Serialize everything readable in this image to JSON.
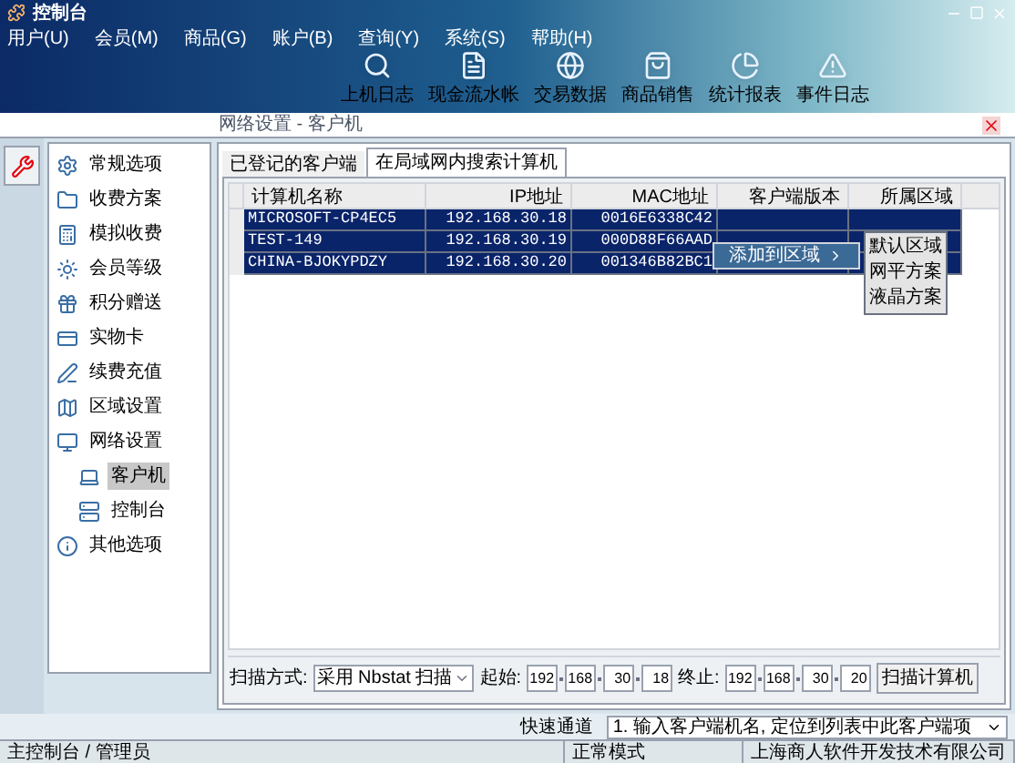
{
  "window": {
    "title": "控制台"
  },
  "menu": [
    "用户(U)",
    "会员(M)",
    "商品(G)",
    "账户(B)",
    "查询(Y)",
    "系统(S)",
    "帮助(H)"
  ],
  "toolbar": [
    "上机日志",
    "现金流水帐",
    "交易数据",
    "商品销售",
    "统计报表",
    "事件日志"
  ],
  "breadcrumb": "网络设置 - 客户机",
  "sidebar": {
    "items": [
      {
        "label": "常规选项",
        "selected": false
      },
      {
        "label": "收费方案",
        "selected": false
      },
      {
        "label": "模拟收费",
        "selected": false
      },
      {
        "label": "会员等级",
        "selected": false
      },
      {
        "label": "积分赠送",
        "selected": false
      },
      {
        "label": "实物卡",
        "selected": false
      },
      {
        "label": "续费充值",
        "selected": false
      },
      {
        "label": "区域设置",
        "selected": false
      },
      {
        "label": "网络设置",
        "selected": false,
        "children": [
          {
            "label": "客户机",
            "selected": true
          },
          {
            "label": "控制台",
            "selected": false
          }
        ]
      },
      {
        "label": "其他选项",
        "selected": false
      }
    ]
  },
  "tabs": [
    {
      "label": "已登记的客户端",
      "selected": false
    },
    {
      "label": "在局域网内搜索计算机",
      "selected": true
    }
  ],
  "table": {
    "columns": [
      "计算机名称",
      "IP地址",
      "MAC地址",
      "客户端版本",
      "所属区域"
    ],
    "rows": [
      {
        "cells": [
          "MICROSOFT-CP4EC5",
          "192.168.30.18",
          "0016E6338C42"
        ],
        "selected": true
      },
      {
        "cells": [
          "TEST-149",
          "192.168.30.19",
          "000D88F66AAD"
        ],
        "selected": true
      },
      {
        "cells": [
          "CHINA-BJOKYPDZY",
          "192.168.30.20",
          "001346B82BC1"
        ],
        "selected": true
      }
    ]
  },
  "context_menu": {
    "item": "添加到区域",
    "submenu": [
      "默认区域",
      "网平方案",
      "液晶方案"
    ]
  },
  "scan": {
    "label": "扫描方式:",
    "method": "采用 Nbstat 扫描",
    "start_label": "起始:",
    "start": [
      "192",
      "168",
      "30",
      "18"
    ],
    "end_label": "终止:",
    "end": [
      "192",
      "168",
      "30",
      "20"
    ],
    "button": "扫描计算机"
  },
  "quick_locate": {
    "label": "快速通道",
    "value": "1. 输入客户端机名, 定位到列表中此客户端项"
  },
  "status_bar": [
    "主控制台 / 管理员",
    "正常模式",
    "上海商人软件开发技术有限公司"
  ]
}
